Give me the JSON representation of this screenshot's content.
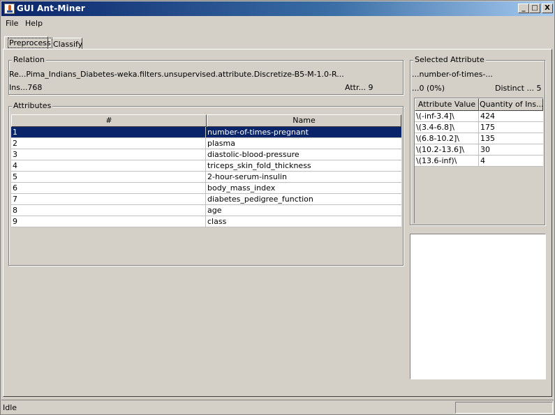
{
  "window": {
    "title": "GUI Ant-Miner",
    "min_label": "_",
    "max_label": "□",
    "close_label": "X"
  },
  "menu": {
    "file": "File",
    "help": "Help"
  },
  "tabs": {
    "preprocess": "Preprocess",
    "classify": "Classify"
  },
  "relation": {
    "label": "Relation",
    "name": "Re...Pima_Indians_Diabetes-weka.filters.unsupervised.attribute.Discretize-B5-M-1.0-R...",
    "instances": "Ins...768",
    "attributes": "Attr... 9"
  },
  "attributes": {
    "label": "Attributes",
    "columns": [
      "#",
      "Name"
    ],
    "rows": [
      {
        "num": "1",
        "name": "number-of-times-pregnant"
      },
      {
        "num": "2",
        "name": "plasma"
      },
      {
        "num": "3",
        "name": "diastolic-blood-pressure"
      },
      {
        "num": "4",
        "name": "triceps_skin_fold_thickness"
      },
      {
        "num": "5",
        "name": "2-hour-serum-insulin"
      },
      {
        "num": "6",
        "name": "body_mass_index"
      },
      {
        "num": "7",
        "name": "diabetes_pedigree_function"
      },
      {
        "num": "8",
        "name": "age"
      },
      {
        "num": "9",
        "name": "class"
      }
    ]
  },
  "selected": {
    "label": "Selected Attribute",
    "name": "...number-of-times-...",
    "missing": "...0 (0%)",
    "distinct": "Distinct ... 5",
    "columns": [
      "Attribute Value",
      "Quantity of Ins..."
    ],
    "rows": [
      {
        "value": "\\(-inf-3.4]\\",
        "qty": "424"
      },
      {
        "value": "\\(3.4-6.8]\\",
        "qty": "175"
      },
      {
        "value": "\\(6.8-10.2]\\",
        "qty": "135"
      },
      {
        "value": "\\(10.2-13.6]\\",
        "qty": "30"
      },
      {
        "value": "\\(13.6-inf)\\",
        "qty": "4"
      }
    ]
  },
  "status": {
    "text": "Idle"
  }
}
